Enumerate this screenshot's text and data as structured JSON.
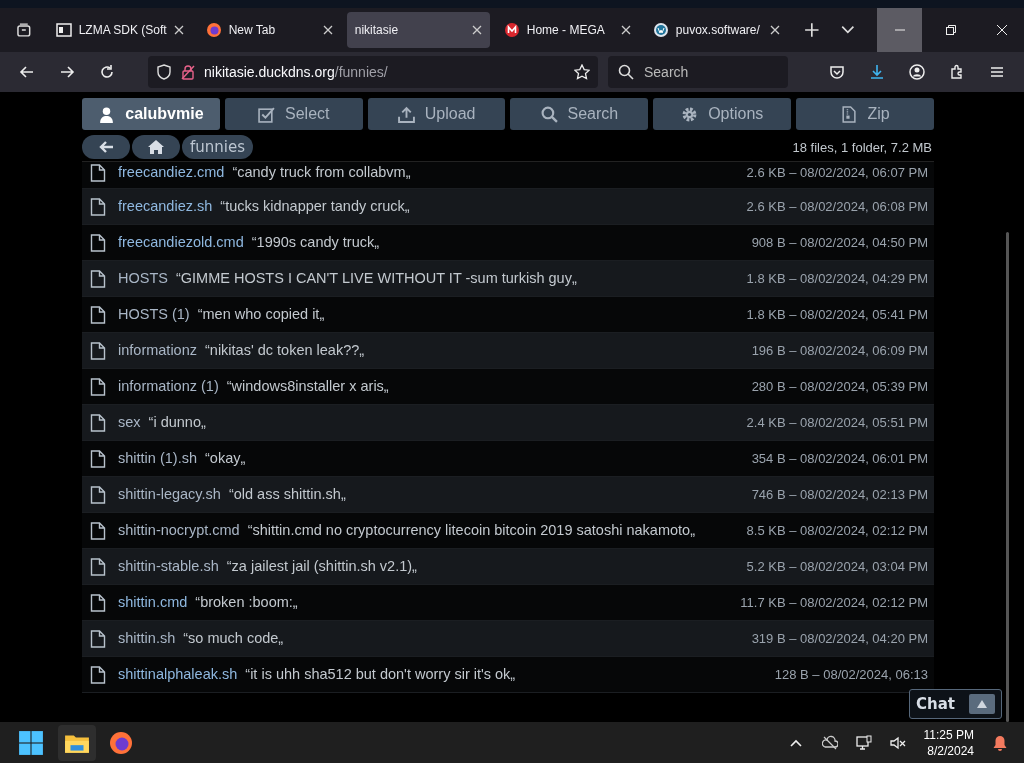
{
  "browser": {
    "tabs": [
      {
        "title": "LZMA SDK (Soft",
        "selected": false
      },
      {
        "title": "New Tab",
        "selected": false
      },
      {
        "title": "nikitasie",
        "selected": true
      },
      {
        "title": "Home - MEGA",
        "selected": false
      },
      {
        "title": "puvox.software/",
        "selected": false
      }
    ],
    "url_host": "nikitasie.duckdns.org",
    "url_path": "/funnies/",
    "search": {
      "placeholder": "Search"
    }
  },
  "toolbar": [
    {
      "label": "calubvmie",
      "kind": "user"
    },
    {
      "label": "Select",
      "kind": "select"
    },
    {
      "label": "Upload",
      "kind": "upload"
    },
    {
      "label": "Search",
      "kind": "search"
    },
    {
      "label": "Options",
      "kind": "options"
    },
    {
      "label": "Zip",
      "kind": "zip"
    }
  ],
  "breadcrumb": {
    "folder": "funnies"
  },
  "summary": "18 files, 1 folder, 7.2 MB",
  "files": [
    {
      "name": "freecandiez.cmd",
      "comment": "“candy truck from collabvm„",
      "meta": "2.6 KB – 08/02/2024, 06:07 PM",
      "color": "#8fb8e0"
    },
    {
      "name": "freecandiez.sh",
      "comment": "“tucks kidnapper tandy cruck„",
      "meta": "2.6 KB – 08/02/2024, 06:08 PM",
      "color": "#8fb8e0"
    },
    {
      "name": "freecandiezold.cmd",
      "comment": "“1990s candy truck„",
      "meta": "908 B – 08/02/2024, 04:50 PM",
      "color": "#8fb8e0"
    },
    {
      "name": "HOSTS",
      "comment": "“GIMME HOSTS I CAN'T LIVE WITHOUT IT -sum turkish guy„",
      "meta": "1.8 KB – 08/02/2024, 04:29 PM",
      "color": "#a9b6c6"
    },
    {
      "name": "HOSTS (1)",
      "comment": "“men who copied it„",
      "meta": "1.8 KB – 08/02/2024, 05:41 PM",
      "color": "#a9b6c6"
    },
    {
      "name": "informationz",
      "comment": "“nikitas' dc token leak??„",
      "meta": "196 B – 08/02/2024, 06:09 PM",
      "color": "#a9b6c6"
    },
    {
      "name": "informationz (1)",
      "comment": "“windows8installer x aris„",
      "meta": "280 B – 08/02/2024, 05:39 PM",
      "color": "#a9b6c6"
    },
    {
      "name": "sex",
      "comment": "“i dunno„",
      "meta": "2.4 KB – 08/02/2024, 05:51 PM",
      "color": "#a9b6c6"
    },
    {
      "name": "shittin (1).sh",
      "comment": "“okay„",
      "meta": "354 B – 08/02/2024, 06:01 PM",
      "color": "#a9b6c6"
    },
    {
      "name": "shittin-legacy.sh",
      "comment": "“old ass shittin.sh„",
      "meta": "746 B – 08/02/2024, 02:13 PM",
      "color": "#a9b6c6"
    },
    {
      "name": "shittin-nocrypt.cmd",
      "comment": "“shittin.cmd no cryptocurrency litecoin bitcoin 2019 satoshi nakamoto„",
      "meta": "8.5 KB – 08/02/2024, 02:12 PM",
      "color": "#a9b6c6"
    },
    {
      "name": "shittin-stable.sh",
      "comment": "“za jailest jail (shittin.sh v2.1)„",
      "meta": "5.2 KB – 08/02/2024, 03:04 PM",
      "color": "#a9b6c6"
    },
    {
      "name": "shittin.cmd",
      "comment": "“broken :boom:„",
      "meta": "11.7 KB – 08/02/2024, 02:12 PM",
      "color": "#8fb8e0"
    },
    {
      "name": "shittin.sh",
      "comment": "“so much code„",
      "meta": "319 B – 08/02/2024, 04:20 PM",
      "color": "#a9b6c6"
    },
    {
      "name": "shittinalphaleak.sh",
      "comment": "“it is uhh sha512 but don't worry sir it's ok„",
      "meta": "128 B – 08/02/2024, 06:13",
      "color": "#8fb8e0"
    }
  ],
  "chat": {
    "label": "Chat"
  },
  "taskbar": {
    "time": "11:25 PM",
    "date": "8/2/2024"
  }
}
